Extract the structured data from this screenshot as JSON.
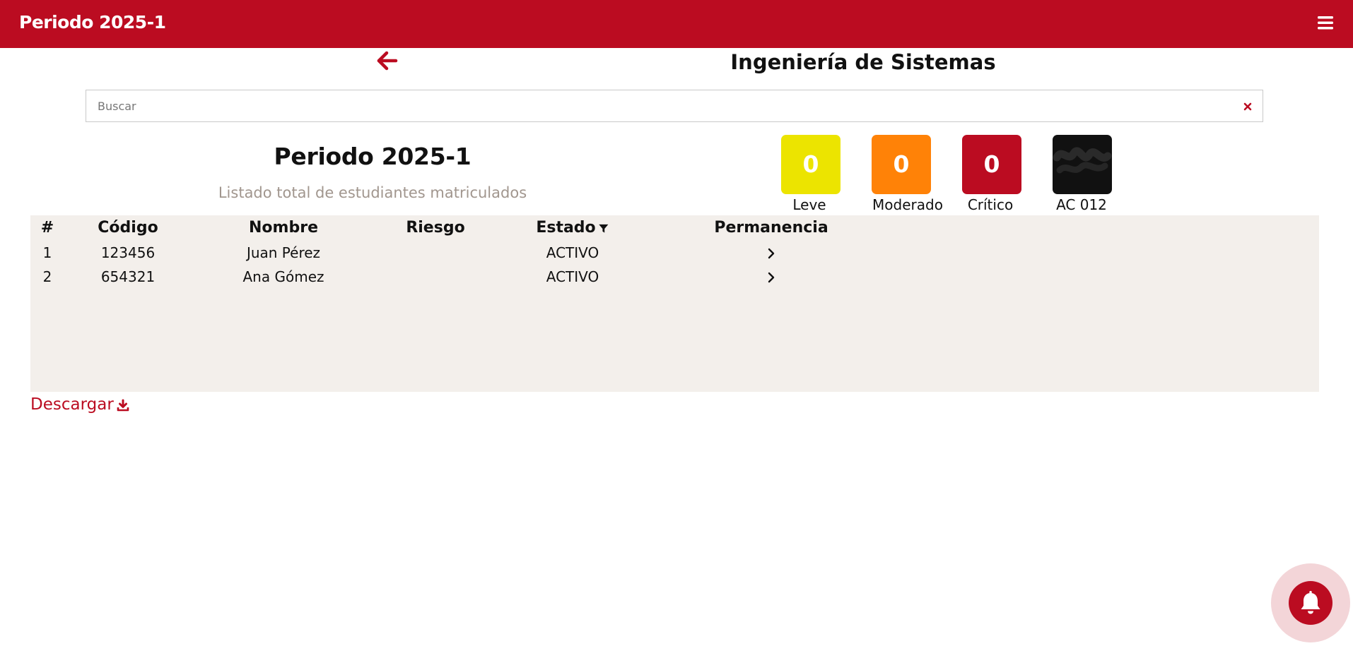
{
  "header": {
    "title": "Periodo 2025-1",
    "menu_icon": "bars-icon"
  },
  "page": {
    "program_name": "Ingeniería de Sistemas",
    "back_icon": "arrow-left-icon"
  },
  "search": {
    "placeholder": "Buscar",
    "value": "",
    "clear_icon": "close-icon"
  },
  "summary": {
    "title": "Periodo 2025-1",
    "subtitle": "Listado total de estudiantes matriculados"
  },
  "risk_cards": [
    {
      "label": "Leve",
      "count": "0",
      "color": "#ece400"
    },
    {
      "label": "Moderado",
      "count": "0",
      "color": "#ff8207"
    },
    {
      "label": "Crítico",
      "count": "0",
      "color": "#bb0c21"
    },
    {
      "label": "AC 012",
      "count": "",
      "color": "#111111"
    }
  ],
  "table": {
    "columns": [
      "#",
      "Código",
      "Nombre",
      "Riesgo",
      "Estado",
      "Permanencia"
    ],
    "rows": [
      {
        "num": "1",
        "codigo": "123456",
        "nombre": "Juan Pérez",
        "riesgo": "",
        "estado": "ACTIVO"
      },
      {
        "num": "2",
        "codigo": "654321",
        "nombre": "Ana Gómez",
        "riesgo": "",
        "estado": "ACTIVO"
      }
    ]
  },
  "download": {
    "label": "Descargar",
    "icon": "download-icon"
  },
  "notifications": {
    "icon": "bell-icon"
  },
  "colors": {
    "brand": "#bb0c21",
    "panel": "#f3efeb",
    "muted_text": "#a1968e"
  }
}
